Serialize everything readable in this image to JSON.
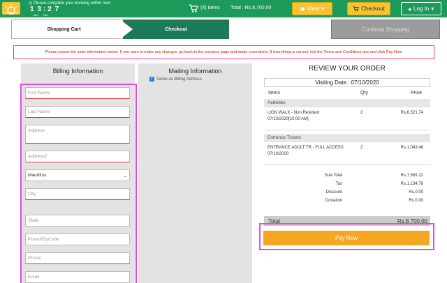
{
  "header": {
    "timer_message": "Please complete your booking within next",
    "timer": {
      "minutes": "1 3",
      "seconds": "2 7",
      "min_label": "Min",
      "sec_label": "Sec"
    },
    "items_count": "(4) Items",
    "total": "Total : Rs.8,700.00",
    "view_label": "View",
    "checkout_label": "Checkout",
    "login_label": "Log In"
  },
  "steps": {
    "cart": "Shopping Cart",
    "checkout": "Checkout",
    "continue": "Continue Shopping"
  },
  "notice": "Please review the order information below. If you want to make any changes, go back to the previous page and make corrections. If everything is correct, tick the Terms and Conditions box and click Pay Now.",
  "billing": {
    "title": "Billing Information",
    "first_name": "First Name",
    "last_name": "Last Name",
    "address": "Address",
    "address2": "Address2",
    "country": "Mauritius",
    "city": "City",
    "state": "State",
    "postal": "Postal/ZipCode",
    "phone": "Phone",
    "email": "Email"
  },
  "mailing": {
    "title": "Mailing Information",
    "same_as_billing": "Same as Billing Address"
  },
  "review": {
    "title": "REVIEW YOUR ORDER",
    "visiting_date": "Visiting Date : 07/10/2020",
    "col_items": "Items",
    "col_qty": "Qty",
    "col_price": "Price",
    "sections": [
      {
        "name": "Activities",
        "item": "LION WALK - Non Resident",
        "item_sub": "07/10/2020[10:00 AM]",
        "qty": "2",
        "price": "Rs.6,521.74"
      },
      {
        "name": "Entrance Tickets",
        "item": "ENTRANCE ADULT TR - FULL ACCESS",
        "item_sub": "07/10/2020",
        "qty": "2",
        "price": "Rs.1,043.48"
      }
    ],
    "subtotal_label": "Sub-Total",
    "subtotal": "Rs.7,565.22",
    "tax_label": "Tax",
    "tax": "Rs.1,134.78",
    "discount_label": "Discount",
    "discount": "Rs.0.00",
    "donation_label": "Donation",
    "donation": "Rs.0.00",
    "total_label": "Total",
    "total": "Rs.8,700.00",
    "pay_label": "Pay Now"
  },
  "colors": {
    "brand_green": "#1c9a5a",
    "accent_yellow": "#f6c433",
    "pay_orange": "#f5a623",
    "highlight": "#e04de0"
  }
}
